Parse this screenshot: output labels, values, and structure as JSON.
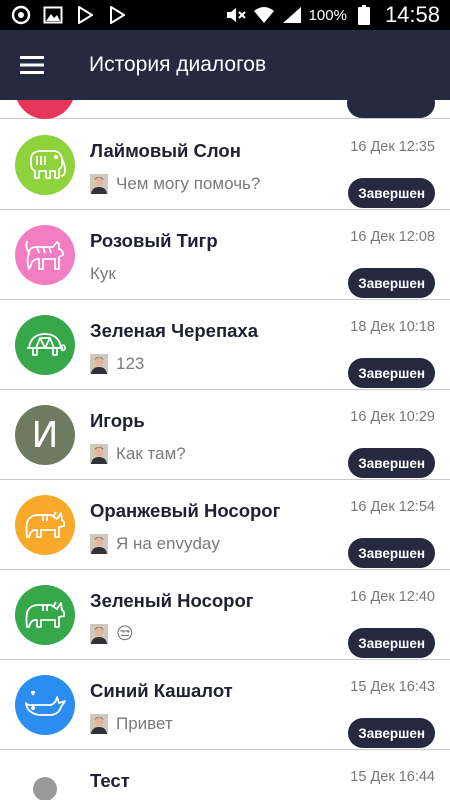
{
  "status_bar": {
    "battery_percent": "100%",
    "time": "14:58",
    "icons": [
      "sync-icon",
      "image-icon",
      "play-store-icon",
      "play-store-icon",
      "mute-icon",
      "wifi-icon",
      "signal-icon",
      "battery-icon"
    ]
  },
  "app_bar": {
    "title": "История диалогов",
    "menu_icon": "hamburger-menu-icon",
    "background": "#262a41"
  },
  "conversations": [
    {
      "name": "Лаймовый Слон",
      "date": "16 Дек 12:35",
      "preview": "Чем могу помочь?",
      "has_operator_avatar": true,
      "status": "Завершен",
      "avatar_color": "#8ed33c",
      "avatar_icon": "elephant-icon"
    },
    {
      "name": "Розовый Тигр",
      "date": "16 Дек 12:08",
      "preview": "Кук",
      "has_operator_avatar": false,
      "status": "Завершен",
      "avatar_color": "#f27dc0",
      "avatar_icon": "tiger-icon"
    },
    {
      "name": "Зеленая Черепаха",
      "date": "18 Дек 10:18",
      "preview": "123",
      "has_operator_avatar": true,
      "status": "Завершен",
      "avatar_color": "#36a84a",
      "avatar_icon": "turtle-icon"
    },
    {
      "name": "Игорь",
      "date": "16 Дек 10:29",
      "preview": "Как там?",
      "has_operator_avatar": true,
      "status": "Завершен",
      "avatar_color": "#6e7a62",
      "avatar_letter": "И"
    },
    {
      "name": "Оранжевый Носорог",
      "date": "16 Дек 12:54",
      "preview": "Я на envyday",
      "has_operator_avatar": true,
      "status": "Завершен",
      "avatar_color": "#f9a92a",
      "avatar_icon": "rhino-icon"
    },
    {
      "name": "Зеленый Носорог",
      "date": "16 Дек 12:40",
      "preview": "😒",
      "has_operator_avatar": true,
      "status": "Завершен",
      "avatar_color": "#36a84a",
      "avatar_icon": "rhino-icon"
    },
    {
      "name": "Синий Кашалот",
      "date": "15 Дек 16:43",
      "preview": "Привет",
      "has_operator_avatar": true,
      "status": "Завершен",
      "avatar_color": "#2b8def",
      "avatar_icon": "whale-icon"
    },
    {
      "name": "Тест",
      "date": "15 Дек 16:44",
      "preview": "",
      "has_operator_avatar": false,
      "status": "",
      "avatar_color": "#ffffff",
      "avatar_icon": "user-silhouette-icon"
    }
  ]
}
